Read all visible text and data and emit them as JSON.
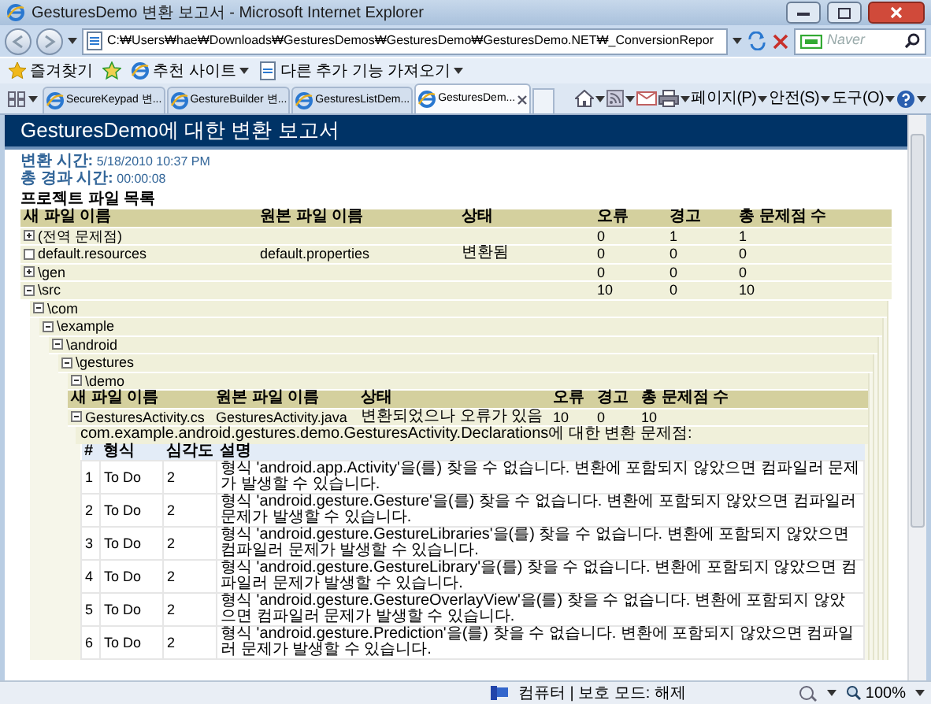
{
  "window": {
    "title": "GesturesDemo 변환 보고서 - Microsoft Internet Explorer"
  },
  "address_bar": {
    "url": "C:₩Users₩hae₩Downloads₩GesturesDemos₩GesturesDemo₩GesturesDemo.NET₩_ConversionRepor",
    "search_placeholder": "Naver"
  },
  "favorites_bar": {
    "items": [
      {
        "label": "즐겨찾기"
      },
      {
        "label": "추천 사이트"
      },
      {
        "label": "다른 추가 기능 가져오기"
      }
    ]
  },
  "tabs": [
    {
      "label": "SecureKeypad 변...",
      "selected": false
    },
    {
      "label": "GestureBuilder 변...",
      "selected": false
    },
    {
      "label": "GesturesListDem...",
      "selected": false
    },
    {
      "label": "GesturesDem...",
      "selected": true
    }
  ],
  "command_bar": {
    "menus": [
      {
        "label": "페이지(P)"
      },
      {
        "label": "안전(S)"
      },
      {
        "label": "도구(O)"
      }
    ]
  },
  "report": {
    "title": "GesturesDemo에 대한 변환 보고서",
    "conversion_time": {
      "label": "변환 시간:",
      "value": "5/18/2010 10:37 PM"
    },
    "elapsed_time": {
      "label": "총 경과 시간:",
      "value": "00:00:08"
    },
    "files_heading": "프로젝트 파일 목록",
    "files": {
      "columns": [
        "새 파일 이름",
        "원본 파일 이름",
        "상태",
        "오류",
        "경고",
        "총 문제점 수"
      ],
      "rows": [
        {
          "name": "(전역 문제점)",
          "expanded": false,
          "original": "",
          "status": "",
          "errors": "0",
          "warnings": "1",
          "total": "1"
        },
        {
          "name": "default.resources",
          "original": "default.properties",
          "status": "변환됨",
          "errors": "0",
          "warnings": "0",
          "total": "0"
        },
        {
          "name": "\\gen",
          "expanded": false,
          "original": "",
          "status": "",
          "errors": "0",
          "warnings": "0",
          "total": "0"
        },
        {
          "name": "\\src",
          "expanded": true,
          "original": "",
          "status": "",
          "errors": "10",
          "warnings": "0",
          "total": "10",
          "children": [
            {
              "name": "\\com",
              "expanded": true,
              "children": [
                {
                  "name": "\\example",
                  "expanded": true,
                  "children": [
                    {
                      "name": "\\android",
                      "expanded": true,
                      "children": [
                        {
                          "name": "\\gestures",
                          "expanded": true,
                          "children": [
                            {
                              "name": "\\demo",
                              "expanded": true,
                              "files": {
                                "columns": [
                                  "새 파일 이름",
                                  "원본 파일 이름",
                                  "상태",
                                  "오류",
                                  "경고",
                                  "총 문제점 수"
                                ],
                                "rows": [
                                  {
                                    "name": "GesturesActivity.cs",
                                    "expanded": true,
                                    "original": "GesturesActivity.java",
                                    "status": "변환되었으나 오류가 있음",
                                    "errors": "10",
                                    "warnings": "0",
                                    "total": "10",
                                    "issues": {
                                      "title": "com.example.android.gestures.demo.GesturesActivity.Declarations에 대한 변환 문제점:",
                                      "columns": [
                                        "#",
                                        "형식",
                                        "심각도",
                                        "설명"
                                      ],
                                      "rows": [
                                        {
                                          "number": "1",
                                          "type": "To Do",
                                          "severity": "2",
                                          "description": "형식 'android.app.Activity'을(를) 찾을 수 없습니다. 변환에 포함되지 않았으면 컴파일러 문제가 발생할 수 있습니다."
                                        },
                                        {
                                          "number": "2",
                                          "type": "To Do",
                                          "severity": "2",
                                          "description": "형식 'android.gesture.Gesture'을(를) 찾을 수 없습니다. 변환에 포함되지 않았으면 컴파일러 문제가 발생할 수 있습니다."
                                        },
                                        {
                                          "number": "3",
                                          "type": "To Do",
                                          "severity": "2",
                                          "description": "형식 'android.gesture.GestureLibraries'을(를) 찾을 수 없습니다. 변환에 포함되지 않았으면 컴파일러 문제가 발생할 수 있습니다."
                                        },
                                        {
                                          "number": "4",
                                          "type": "To Do",
                                          "severity": "2",
                                          "description": "형식 'android.gesture.GestureLibrary'을(를) 찾을 수 없습니다. 변환에 포함되지 않았으면 컴파일러 문제가 발생할 수 있습니다."
                                        },
                                        {
                                          "number": "5",
                                          "type": "To Do",
                                          "severity": "2",
                                          "description": "형식 'android.gesture.GestureOverlayView'을(를) 찾을 수 없습니다. 변환에 포함되지 않았으면 컴파일러 문제가 발생할 수 있습니다."
                                        },
                                        {
                                          "number": "6",
                                          "type": "To Do",
                                          "severity": "2",
                                          "description": "형식 'android.gesture.Prediction'을(를) 찾을 수 없습니다. 변환에 포함되지 않았으면 컴파일러 문제가 발생할 수 있습니다."
                                        }
                                      ]
                                    }
                                  }
                                ]
                              }
                            }
                          ]
                        }
                      ]
                    }
                  ]
                }
              ]
            }
          ]
        }
      ]
    }
  },
  "status_bar": {
    "zone": "컴퓨터 | 보호 모드: 해제",
    "zoom": "100%"
  }
}
